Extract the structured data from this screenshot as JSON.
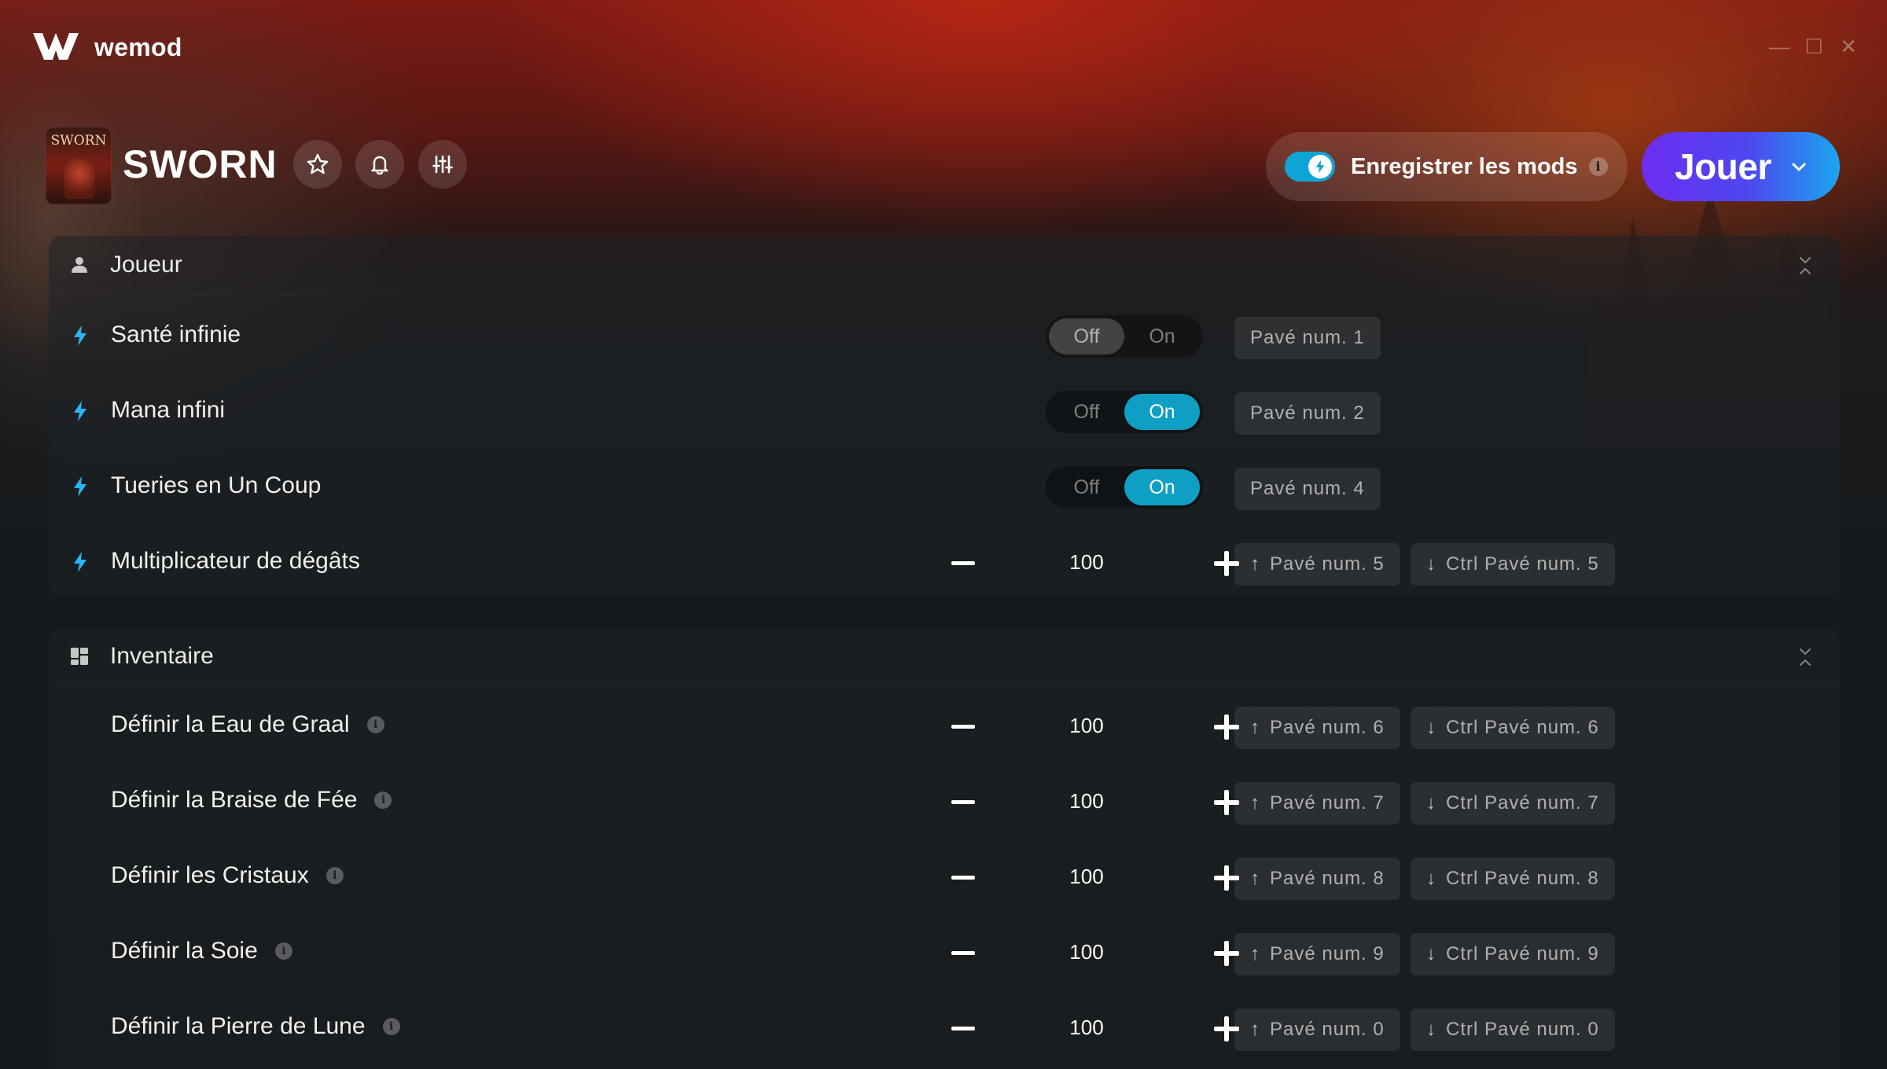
{
  "app": {
    "brand": "wemod"
  },
  "window": {
    "minimize": "—",
    "maximize": "☐",
    "close": "✕"
  },
  "game": {
    "title": "SWORN",
    "cover_text": "SWORN"
  },
  "header": {
    "save_mods_label": "Enregistrer les mods",
    "save_mods_enabled": true,
    "info": "i",
    "play_label": "Jouer"
  },
  "sections": [
    {
      "title": "Joueur",
      "icon": "person-icon",
      "rows": [
        {
          "label": "Santé infinie",
          "type": "toggle",
          "off": "Off",
          "on": "On",
          "state": "Off",
          "hotkey": "Pavé num. 1"
        },
        {
          "label": "Mana infini",
          "type": "toggle",
          "off": "Off",
          "on": "On",
          "state": "On",
          "hotkey": "Pavé num. 2"
        },
        {
          "label": "Tueries en Un Coup",
          "type": "toggle",
          "off": "Off",
          "on": "On",
          "state": "On",
          "hotkey": "Pavé num. 4"
        },
        {
          "label": "Multiplicateur de dégâts",
          "type": "number",
          "value": "100",
          "hotkey_up": "Pavé num. 5",
          "hotkey_down": "Ctrl Pavé num. 5"
        }
      ]
    },
    {
      "title": "Inventaire",
      "icon": "grid-icon",
      "rows": [
        {
          "label": "Définir la Eau de Graal",
          "type": "number",
          "value": "100",
          "hotkey_up": "Pavé num. 6",
          "hotkey_down": "Ctrl Pavé num. 6",
          "info": "i"
        },
        {
          "label": "Définir la Braise de Fée",
          "type": "number",
          "value": "100",
          "hotkey_up": "Pavé num. 7",
          "hotkey_down": "Ctrl Pavé num. 7",
          "info": "i"
        },
        {
          "label": "Définir les Cristaux",
          "type": "number",
          "value": "100",
          "hotkey_up": "Pavé num. 8",
          "hotkey_down": "Ctrl Pavé num. 8",
          "info": "i"
        },
        {
          "label": "Définir la Soie",
          "type": "number",
          "value": "100",
          "hotkey_up": "Pavé num. 9",
          "hotkey_down": "Ctrl Pavé num. 9",
          "info": "i"
        },
        {
          "label": "Définir la Pierre de Lune",
          "type": "number",
          "value": "100",
          "hotkey_up": "Pavé num. 0",
          "hotkey_down": "Ctrl Pavé num. 0",
          "info": "i"
        }
      ]
    }
  ],
  "colors": {
    "accent": "#109fc4",
    "play_start": "#6f2cf0",
    "play_end": "#1aa6ef",
    "bolt": "#29b6f6"
  }
}
